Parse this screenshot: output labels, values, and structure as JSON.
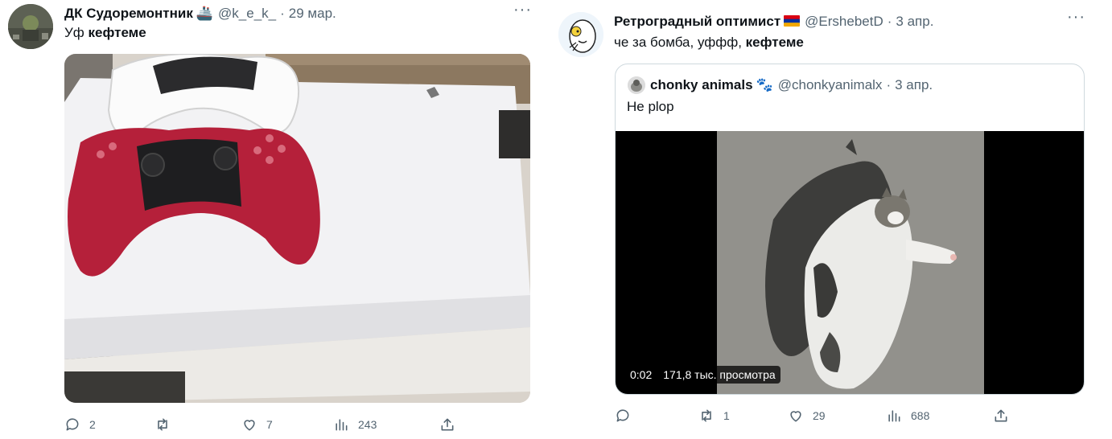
{
  "tweet1": {
    "name": "ДК Судоремонтник",
    "badge_emoji": "🚢",
    "handle": "@k_e_k_",
    "separator": "·",
    "date": "29 мар.",
    "more_label": "···",
    "text_prefix": "Уф ",
    "text_bold": "кефтеме",
    "actions": {
      "replies": "2",
      "reposts": "",
      "likes": "7",
      "views": "243"
    }
  },
  "tweet2": {
    "name": "Ретроградный оптимист",
    "badge": "armenian-flag",
    "flag_colors": [
      "#d90012",
      "#0033a0",
      "#f2a800"
    ],
    "handle": "@ErshebetD",
    "separator": "·",
    "date": "3 апр.",
    "more_label": "···",
    "text_prefix": "че за бомба, уффф, ",
    "text_bold": "кефтеме",
    "quote": {
      "name": "chonky animals",
      "badge_emoji": "🐾",
      "handle": "@chonkyanimalx",
      "separator": "·",
      "date": "3 апр.",
      "text": "Не plop",
      "video_time": "0:02",
      "video_views": "171,8 тыс. просмотра"
    },
    "actions": {
      "replies": "",
      "reposts": "1",
      "likes": "29",
      "views": "688"
    }
  },
  "colors": {
    "text": "#0f1419",
    "secondary": "#536471",
    "border": "#cfd9de"
  }
}
